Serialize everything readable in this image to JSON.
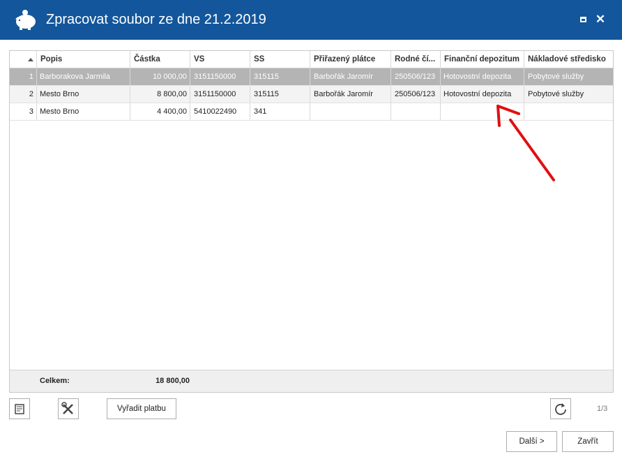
{
  "window": {
    "title": "Zpracovat soubor ze dne 21.2.2019",
    "icon": "piggy-bank-icon",
    "max_icon": "maximize-icon",
    "close_icon": "close-icon",
    "titlebar_color": "#13569b"
  },
  "grid": {
    "columns": [
      "",
      "Popis",
      "Částka",
      "VS",
      "SS",
      "Přiřazený plátce",
      "Rodné čí...",
      "Finanční depozitum",
      "Nákladové středisko"
    ],
    "rows": [
      {
        "n": "1",
        "popis": "Barborakova Jarmila",
        "castka": "10 000,00",
        "vs": "3151150000",
        "ss": "315115",
        "platce": "Barbořák Jaromír",
        "rodne": "250506/123",
        "depozitum": "Hotovostní depozita",
        "stredisko": "Pobytové služby",
        "state": "selected"
      },
      {
        "n": "2",
        "popis": "Mesto Brno",
        "castka": "8 800,00",
        "vs": "3151150000",
        "ss": "315115",
        "platce": "Barbořák Jaromír",
        "rodne": "250506/123",
        "depozitum": "Hotovostní depozita",
        "stredisko": "Pobytové služby",
        "state": "alt"
      },
      {
        "n": "3",
        "popis": "Mesto Brno",
        "castka": "4 400,00",
        "vs": "5410022490",
        "ss": "341",
        "platce": "",
        "rodne": "",
        "depozitum": "",
        "stredisko": "",
        "state": "normal"
      }
    ],
    "footer": {
      "label": "Celkem:",
      "total": "18 800,00"
    }
  },
  "toolbar": {
    "notes_icon": "notes-icon",
    "tools_icon": "tools-icon",
    "exclude_label": "Vyřadit platbu",
    "refresh_icon": "refresh-icon",
    "pager": "1/3"
  },
  "buttons": {
    "next_label": "Další >",
    "close_label": "Zavřít"
  },
  "annotation": {
    "arrow_color": "#e01010"
  }
}
